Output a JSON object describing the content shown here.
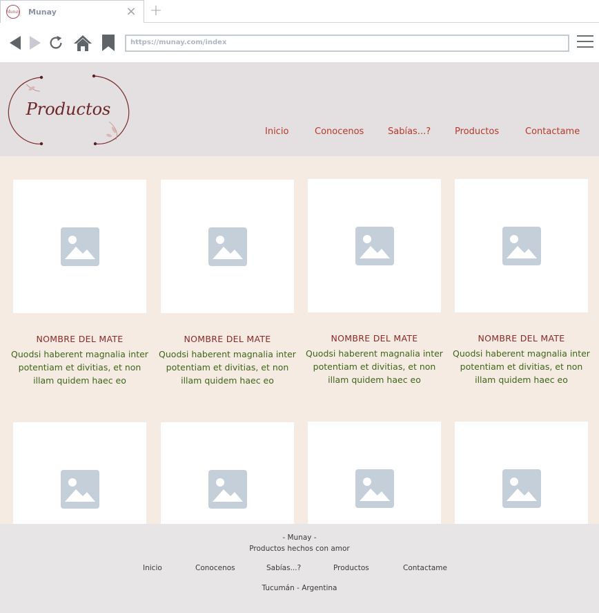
{
  "browser": {
    "tab": {
      "favicon_text": "Munay",
      "title": "Munay"
    },
    "url": "https://munay.com/index",
    "icons": [
      "back-icon",
      "forward-icon",
      "reload-icon",
      "home-icon",
      "bookmark-icon",
      "close-icon",
      "plus-icon",
      "hamburger-menu-icon"
    ]
  },
  "header": {
    "logo_text": "Productos",
    "nav": [
      "Inicio",
      "Conocenos",
      "Sabías...?",
      "Productos",
      "Contactame"
    ]
  },
  "products": [
    {
      "name": "NOMBRE DEL MATE",
      "desc": "Quodsi haberent magnalia inter potentiam et divitias, et non illam quidem haec eo"
    },
    {
      "name": "NOMBRE DEL MATE",
      "desc": "Quodsi haberent magnalia inter potentiam et divitias, et non illam quidem haec eo"
    },
    {
      "name": "NOMBRE DEL MATE",
      "desc": "Quodsi haberent magnalia inter potentiam et divitias, et non illam quidem haec eo"
    },
    {
      "name": "NOMBRE DEL MATE",
      "desc": "Quodsi haberent magnalia inter potentiam et divitias, et non illam quidem haec eo"
    },
    {
      "name": "",
      "desc": ""
    },
    {
      "name": "",
      "desc": ""
    },
    {
      "name": "",
      "desc": ""
    },
    {
      "name": "",
      "desc": ""
    }
  ],
  "footer": {
    "brand": "- Munay -",
    "tagline": "Productos hechos con amor",
    "nav": [
      "Inicio",
      "Conocenos",
      "Sabías...?",
      "Productos",
      "Contactame"
    ],
    "location": "Tucumán - Argentina"
  },
  "colors": {
    "header_bg": "#e4dfe0",
    "content_bg": "#f5ebe3",
    "footer_bg": "#e7e5e6",
    "nav_link": "#b33a2a",
    "product_title": "#8c2828",
    "product_desc": "#3e6518",
    "placeholder_icon": "#c5cfda"
  }
}
